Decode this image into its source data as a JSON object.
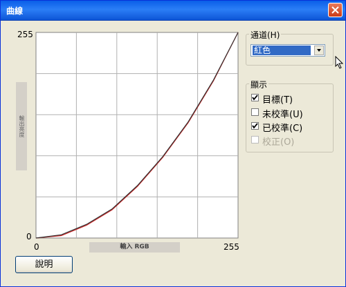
{
  "window": {
    "title": "曲線"
  },
  "chart_data": {
    "type": "line",
    "xlabel": "輸入 RGB",
    "ylabel": "輸出亮度",
    "xlim": [
      0,
      255
    ],
    "ylim": [
      0,
      255
    ],
    "x_ticks": [
      "0",
      "255"
    ],
    "y_ticks": [
      "0",
      "255"
    ],
    "grid": true,
    "series": [
      {
        "color": "#cc2222",
        "x": [
          0,
          32,
          64,
          96,
          128,
          160,
          192,
          224,
          255
        ],
        "y": [
          0,
          3,
          16,
          35,
          64,
          100,
          143,
          195,
          255
        ]
      },
      {
        "color": "#333333",
        "x": [
          0,
          32,
          64,
          96,
          128,
          160,
          192,
          224,
          255
        ],
        "y": [
          0,
          4,
          17,
          36,
          65,
          101,
          144,
          196,
          255
        ]
      }
    ]
  },
  "channel": {
    "label": "通道(H)",
    "value": "紅色"
  },
  "display": {
    "label": "顯示",
    "items": [
      {
        "label": "目標(T)",
        "checked": true,
        "enabled": true
      },
      {
        "label": "未校準(U)",
        "checked": false,
        "enabled": true
      },
      {
        "label": "已校準(C)",
        "checked": true,
        "enabled": true
      },
      {
        "label": "校正(O)",
        "checked": false,
        "enabled": false
      }
    ]
  },
  "help_label": "說明",
  "colors": {
    "accent": "#316ac5",
    "titlebar": "#0a5ee8",
    "curve": "#cc2222"
  }
}
